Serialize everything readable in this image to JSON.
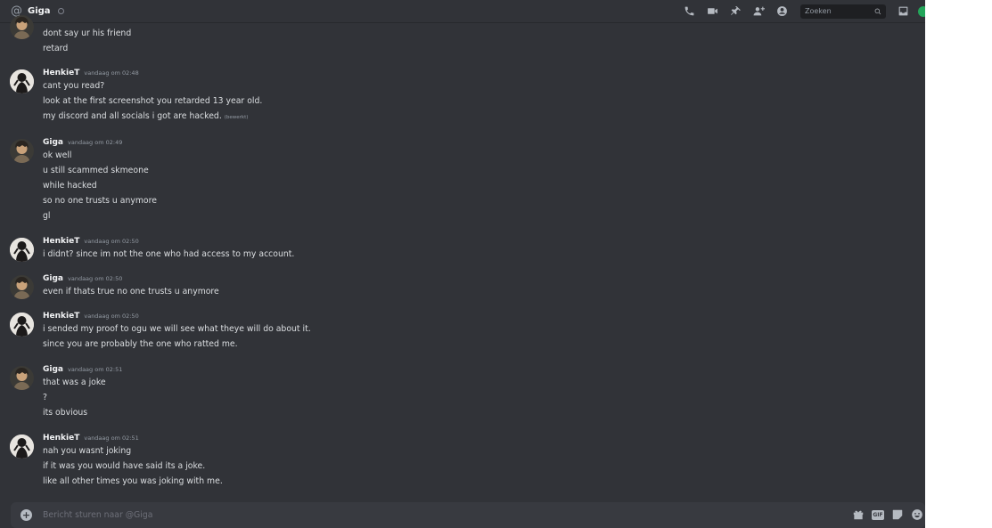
{
  "header": {
    "dm_name": "Giga",
    "search_placeholder": "Zoeken",
    "icons": [
      "at-icon",
      "call-icon",
      "video-icon",
      "pin-icon",
      "add-friend-icon",
      "profile-icon",
      "search-icon",
      "inbox-icon",
      "help-icon"
    ]
  },
  "messages": [
    {
      "author": "",
      "timestamp": "",
      "lines": [
        "dont say ur his friend",
        "retard"
      ]
    },
    {
      "author": "HenkieT",
      "timestamp": "vandaag om 02:48",
      "lines": [
        "cant you read?",
        "look at the first screenshot you retarded 13 year old.",
        "my discord and all socials i got are hacked."
      ],
      "edited_label": "(bewerkt)"
    },
    {
      "author": "Giga",
      "timestamp": "vandaag om 02:49",
      "lines": [
        "ok well",
        "u still scammed skmeone",
        "while hacked",
        "so no one trusts u anymore",
        "gl"
      ]
    },
    {
      "author": "HenkieT",
      "timestamp": "vandaag om 02:50",
      "lines": [
        "i didnt? since im not the one who had access to my account."
      ]
    },
    {
      "author": "Giga",
      "timestamp": "vandaag om 02:50",
      "lines": [
        "even if thats true no one trusts u anymore"
      ]
    },
    {
      "author": "HenkieT",
      "timestamp": "vandaag om 02:50",
      "lines": [
        "i sended my proof to ogu we will see what theye will do about it.",
        "since you are probably the one who ratted me."
      ]
    },
    {
      "author": "Giga",
      "timestamp": "vandaag om 02:51",
      "lines": [
        "that was a joke",
        "?",
        "its obvious"
      ]
    },
    {
      "author": "HenkieT",
      "timestamp": "vandaag om 02:51",
      "lines": [
        "nah you wasnt joking",
        "if it was you would have said its a joke.",
        "like all other times you was joking with me."
      ]
    }
  ],
  "composer": {
    "placeholder": "Bericht sturen naar @Giga",
    "gif_label": "GIF"
  },
  "colors": {
    "background": "#313338",
    "header_text": "#f2f3f5",
    "message_text": "#dbdee1",
    "timestamp": "#949ba4",
    "composer_bg": "#383a40",
    "status_online": "#23a55a"
  }
}
